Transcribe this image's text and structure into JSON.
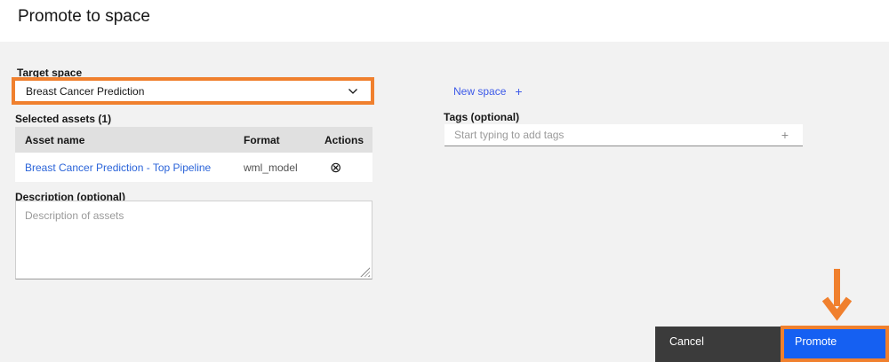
{
  "page": {
    "title": "Promote to space"
  },
  "colors": {
    "annotation_orange": "#f0802e",
    "primary_blue": "#1560f2",
    "link_blue": "#3d5ae8",
    "asset_link_blue": "#2b64d9",
    "body_gray": "#f2f2f2",
    "table_header_gray": "#e0e0e0",
    "cancel_dark": "#3b3b3b"
  },
  "target_space": {
    "label": "Target space",
    "selected_value": "Breast Cancer Prediction"
  },
  "new_space": {
    "label": "New space",
    "plus_icon": "+"
  },
  "selected_assets": {
    "heading": "Selected assets (1)",
    "columns": {
      "asset_name": "Asset name",
      "format": "Format",
      "actions": "Actions"
    },
    "rows": [
      {
        "asset_name": "Breast Cancer Prediction - Top Pipeline",
        "format": "wml_model"
      }
    ]
  },
  "tags": {
    "label": "Tags (optional)",
    "placeholder": "Start typing to add tags",
    "add_icon": "+"
  },
  "description": {
    "label": "Description (optional)",
    "placeholder": "Description of assets"
  },
  "footer": {
    "cancel_label": "Cancel",
    "promote_label": "Promote"
  },
  "icons": {
    "remove": "⊗"
  }
}
